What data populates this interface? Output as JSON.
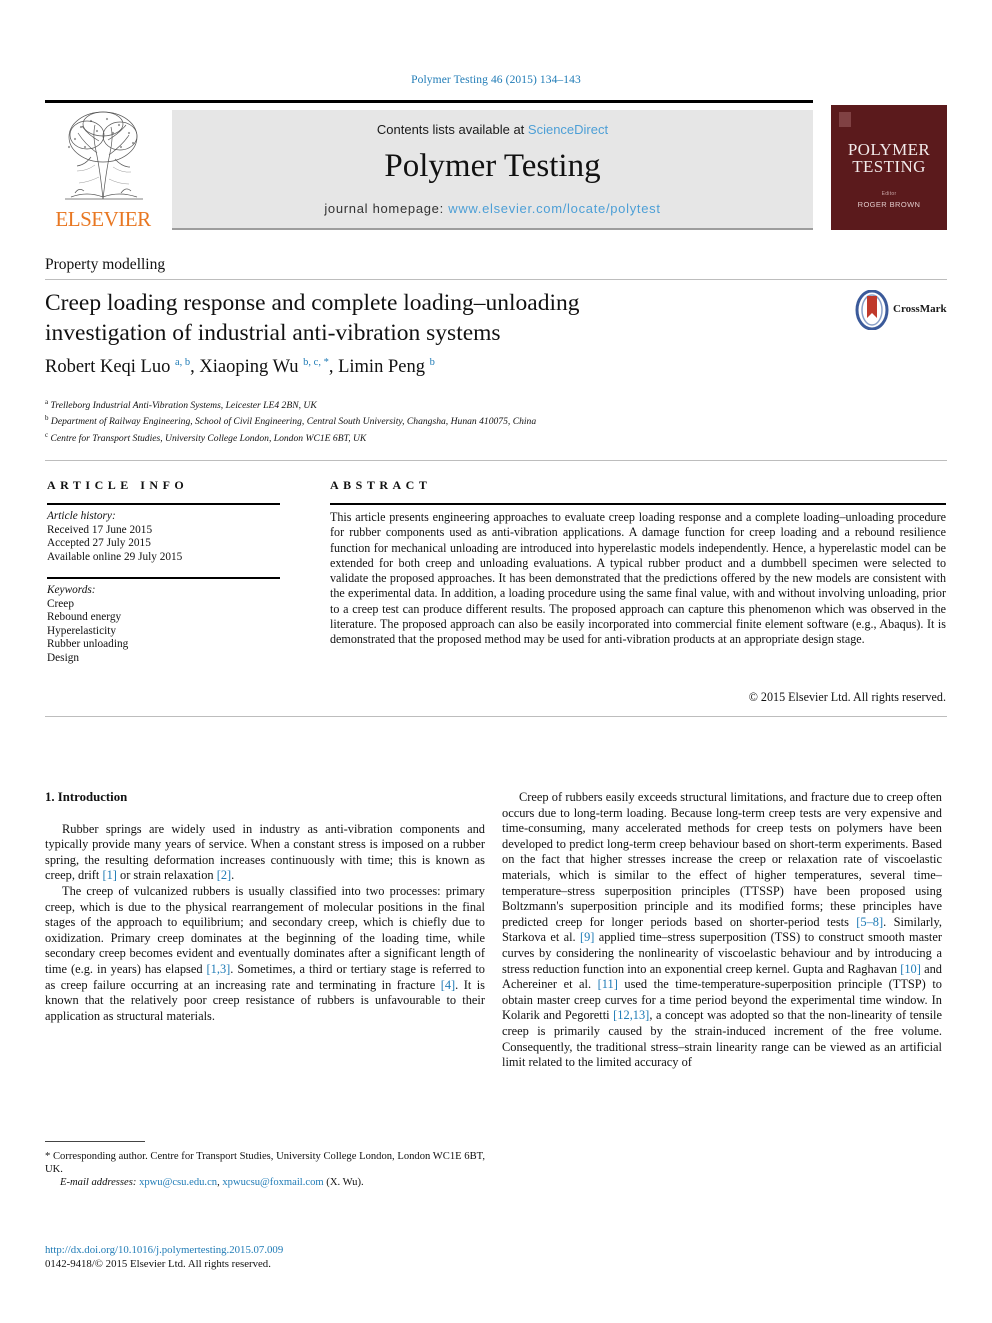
{
  "running_head": "Polymer Testing 46 (2015) 134–143",
  "masthead": {
    "contents_prefix": "Contents lists available at ",
    "contents_link": "ScienceDirect",
    "journal_name": "Polymer Testing",
    "homepage_prefix": "journal homepage: ",
    "homepage_url": "www.elsevier.com/locate/polytest",
    "publisher_logo_text": "ELSEVIER",
    "cover": {
      "title_line1": "POLYMER",
      "title_line2": "TESTING",
      "sub_line1": "Editor",
      "sub_line2": "ROGER BROWN"
    }
  },
  "article": {
    "section_label": "Property modelling",
    "title_line1": "Creep loading response and complete loading–unloading",
    "title_line2": "investigation of industrial anti-vibration systems",
    "authors_html": "Robert Keqi Luo <sup>a, b</sup>, Xiaoping Wu <sup>b, c, *</sup>, Limin Peng <sup>b</sup>",
    "affiliations": [
      {
        "mark": "a",
        "text": "Trelleborg Industrial Anti-Vibration Systems, Leicester LE4 2BN, UK"
      },
      {
        "mark": "b",
        "text": "Department of Railway Engineering, School of Civil Engineering, Central South University, Changsha, Hunan 410075, China"
      },
      {
        "mark": "c",
        "text": "Centre for Transport Studies, University College London, London WC1E 6BT, UK"
      }
    ],
    "crossmark_label": "CrossMark"
  },
  "article_info": {
    "heading": "ARTICLE INFO",
    "history_label": "Article history:",
    "history": [
      "Received 17 June 2015",
      "Accepted 27 July 2015",
      "Available online 29 July 2015"
    ],
    "keywords_label": "Keywords:",
    "keywords": [
      "Creep",
      "Rebound energy",
      "Hyperelasticity",
      "Rubber unloading",
      "Design"
    ]
  },
  "abstract": {
    "heading": "ABSTRACT",
    "text": "This article presents engineering approaches to evaluate creep loading response and a complete loading–unloading procedure for rubber components used as anti-vibration applications. A damage function for creep loading and a rebound resilience function for mechanical unloading are introduced into hyperelastic models independently. Hence, a hyperelastic model can be extended for both creep and unloading evaluations. A typical rubber product and a dumbbell specimen were selected to validate the proposed approaches. It has been demonstrated that the predictions offered by the new models are consistent with the experimental data. In addition, a loading procedure using the same final value, with and without involving unloading, prior to a creep test can produce different results. The proposed approach can capture this phenomenon which was observed in the literature. The proposed approach can also be easily incorporated into commercial finite element software (e.g., Abaqus). It is demonstrated that the proposed method may be used for anti-vibration products at an appropriate design stage.",
    "copyright": "© 2015 Elsevier Ltd. All rights reserved."
  },
  "body": {
    "section_heading": "1. Introduction",
    "left_paragraphs": [
      "Rubber springs are widely used in industry as anti-vibration components and typically provide many years of service. When a constant stress is imposed on a rubber spring, the resulting deformation increases continuously with time; this is known as creep, drift [1] or strain relaxation [2].",
      "The creep of vulcanized rubbers is usually classified into two processes: primary creep, which is due to the physical rearrangement of molecular positions in the final stages of the approach to equilibrium; and secondary creep, which is chiefly due to oxidization. Primary creep dominates at the beginning of the loading time, while secondary creep becomes evident and eventually dominates after a significant length of time (e.g. in years) has elapsed [1,3]. Sometimes, a third or tertiary stage is referred to as creep failure occurring at an increasing rate and terminating in fracture [4]. It is known that the relatively poor creep resistance of rubbers is unfavourable to their application as structural materials."
    ],
    "right_paragraphs": [
      "Creep of rubbers easily exceeds structural limitations, and fracture due to creep often occurs due to long-term loading. Because long-term creep tests are very expensive and time-consuming, many accelerated methods for creep tests on polymers have been developed to predict long-term creep behaviour based on short-term experiments. Based on the fact that higher stresses increase the creep or relaxation rate of viscoelastic materials, which is similar to the effect of higher temperatures, several time–temperature–stress superposition principles (TTSSP) have been proposed using Boltzmann's superposition principle and its modified forms; these principles have predicted creep for longer periods based on shorter-period tests [5–8]. Similarly, Starkova et al. [9] applied time–stress superposition (TSS) to construct smooth master curves by considering the nonlinearity of viscoelastic behaviour and by introducing a stress reduction function into an exponential creep kernel. Gupta and Raghavan [10] and Achereiner et al. [11] used the time-temperature-superposition principle (TTSP) to obtain master creep curves for a time period beyond the experimental time window. In Kolarik and Pegoretti [12,13], a concept was adopted so that the non-linearity of tensile creep is primarily caused by the strain-induced increment of the free volume. Consequently, the traditional stress–strain linearity range can be viewed as an artificial limit related to the limited accuracy of"
    ]
  },
  "footnotes": {
    "corresponding": "* Corresponding author. Centre for Transport Studies, University College London, London WC1E 6BT, UK.",
    "email_label": "E-mail addresses:",
    "email_1": "xpwu@csu.edu.cn",
    "email_2": "xpwucsu@foxmail.com",
    "email_suffix": "(X. Wu).",
    "doi": "http://dx.doi.org/10.1016/j.polymertesting.2015.07.009",
    "issn": "0142-9418/© 2015 Elsevier Ltd. All rights reserved."
  }
}
